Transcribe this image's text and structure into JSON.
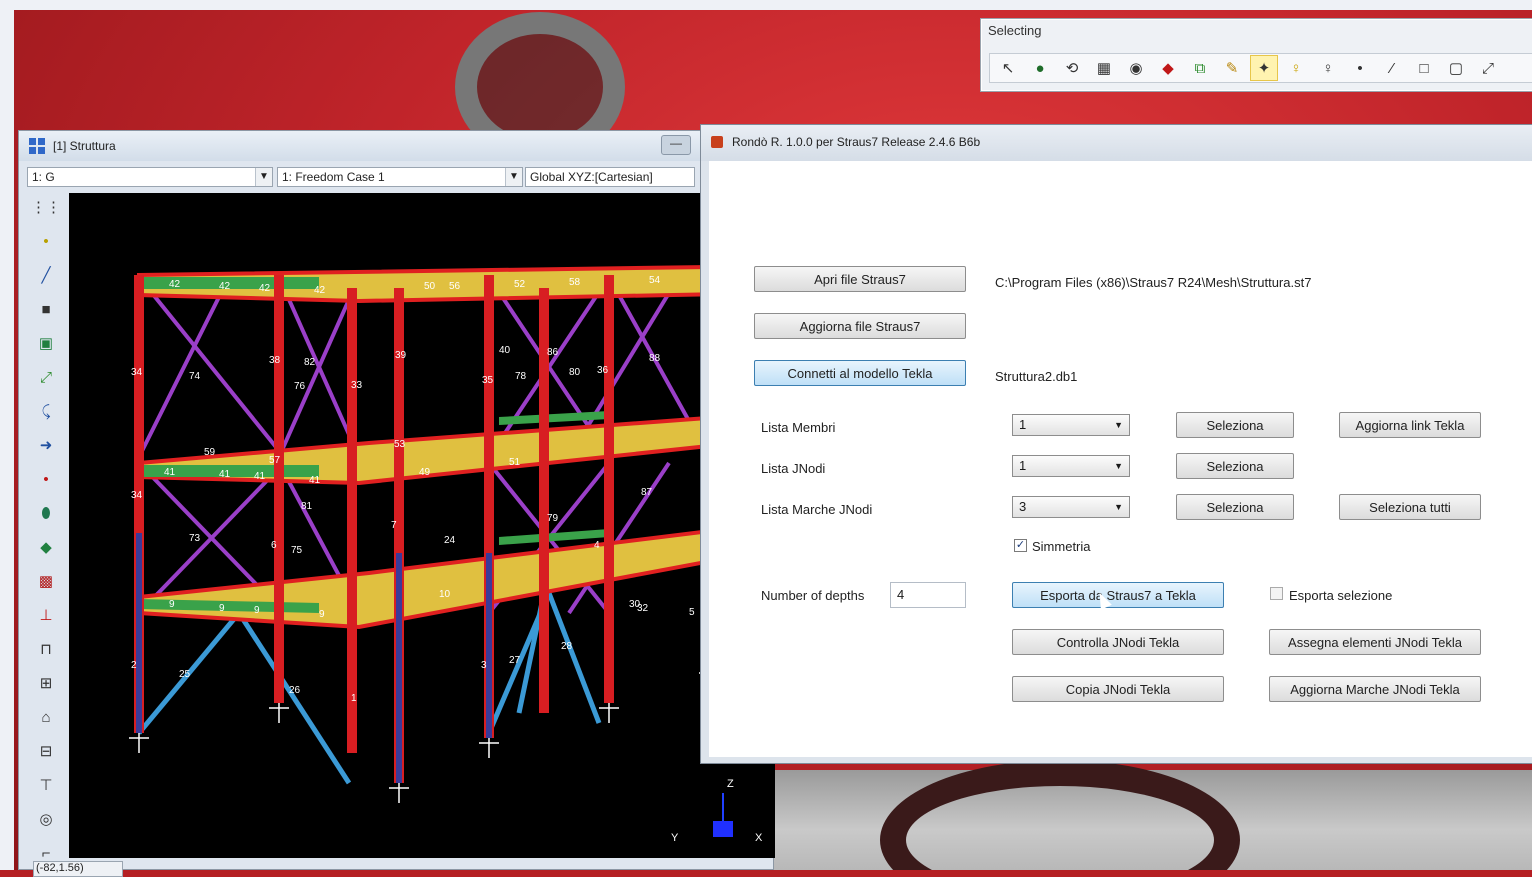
{
  "selecting_toolbar": {
    "title": "Selecting",
    "tools": [
      "pointer-icon",
      "globe-icon",
      "lasso-icon",
      "grid-select-icon",
      "sphere-icon",
      "flag-icon",
      "group-icon",
      "pencil-icon",
      "node-icon",
      "bulb-icon",
      "pin-icon",
      "dot-icon",
      "line-icon",
      "rect-icon",
      "box-icon",
      "arrow-icon"
    ]
  },
  "struttura_window": {
    "title": "[1] Struttura",
    "minimize_glyph": "—",
    "dropdown_group": "1: G",
    "dropdown_freedom": "1: Freedom Case 1",
    "dropdown_coord": "Global XYZ:[Cartesian]",
    "status": "(-82,1.56)",
    "axis_labels": {
      "z": "Z",
      "y": "Y",
      "x": "X"
    },
    "tools": [
      "dots-grid-icon",
      "node-icon",
      "beam-icon",
      "plate-icon",
      "brick-icon",
      "link-icon",
      "load-icon",
      "arrow-right-icon",
      "point-icon",
      "cylinder-icon",
      "ruler-icon",
      "mesh-icon",
      "restraint-icon",
      "frame-icon",
      "grid-icon",
      "tower-icon",
      "block-icon",
      "truss-icon",
      "cap-icon",
      "bracket-icon"
    ],
    "member_numbers": {
      "top": [
        "42",
        "42",
        "42",
        "42",
        "50",
        "54",
        "52",
        "58",
        "56"
      ],
      "mid": [
        "41",
        "41",
        "41",
        "41",
        "51",
        "53",
        "49",
        "57",
        "59"
      ],
      "low": [
        "9",
        "9",
        "9",
        "9",
        "10",
        "24"
      ],
      "columns": [
        "34",
        "34",
        "2",
        "38",
        "39",
        "33",
        "35",
        "36",
        "40",
        "6",
        "7",
        "4",
        "3",
        "1",
        "5"
      ],
      "braces": [
        "74",
        "73",
        "82",
        "76",
        "79",
        "80",
        "81",
        "86",
        "87",
        "88",
        "75",
        "78",
        "25",
        "26",
        "27",
        "28",
        "30",
        "32"
      ]
    }
  },
  "rondo_window": {
    "title": "Rondò R. 1.0.0 per Straus7 Release 2.4.6 B6b",
    "buttons": {
      "open": "Apri file Straus7",
      "update": "Aggiorna file Straus7",
      "connect": "Connetti al modello Tekla",
      "sel1": "Seleziona",
      "sel2": "Seleziona",
      "sel3": "Seleziona",
      "update_link": "Aggiorna link Tekla",
      "select_all": "Seleziona tutti",
      "export": "Esporta da Straus7 a Tekla",
      "check": "Controlla JNodi Tekla",
      "assign": "Assegna elementi JNodi Tekla",
      "copy": "Copia JNodi Tekla",
      "update_marks": "Aggiorna Marche JNodi Tekla"
    },
    "file_path": "C:\\Program Files (x86)\\Straus7 R24\\Mesh\\Struttura.st7",
    "model_name": "Struttura2.db1",
    "labels": {
      "members": "Lista Membri",
      "jnodes": "Lista JNodi",
      "marks": "Lista Marche JNodi",
      "depths": "Number of depths"
    },
    "combos": {
      "members": "1",
      "jnodes": "1",
      "marks": "3"
    },
    "symmetry": {
      "label": "Simmetria",
      "checked": true,
      "mark": "✓"
    },
    "export_selection": {
      "label": "Esporta selezione",
      "checked": false
    },
    "depths_value": "4"
  }
}
